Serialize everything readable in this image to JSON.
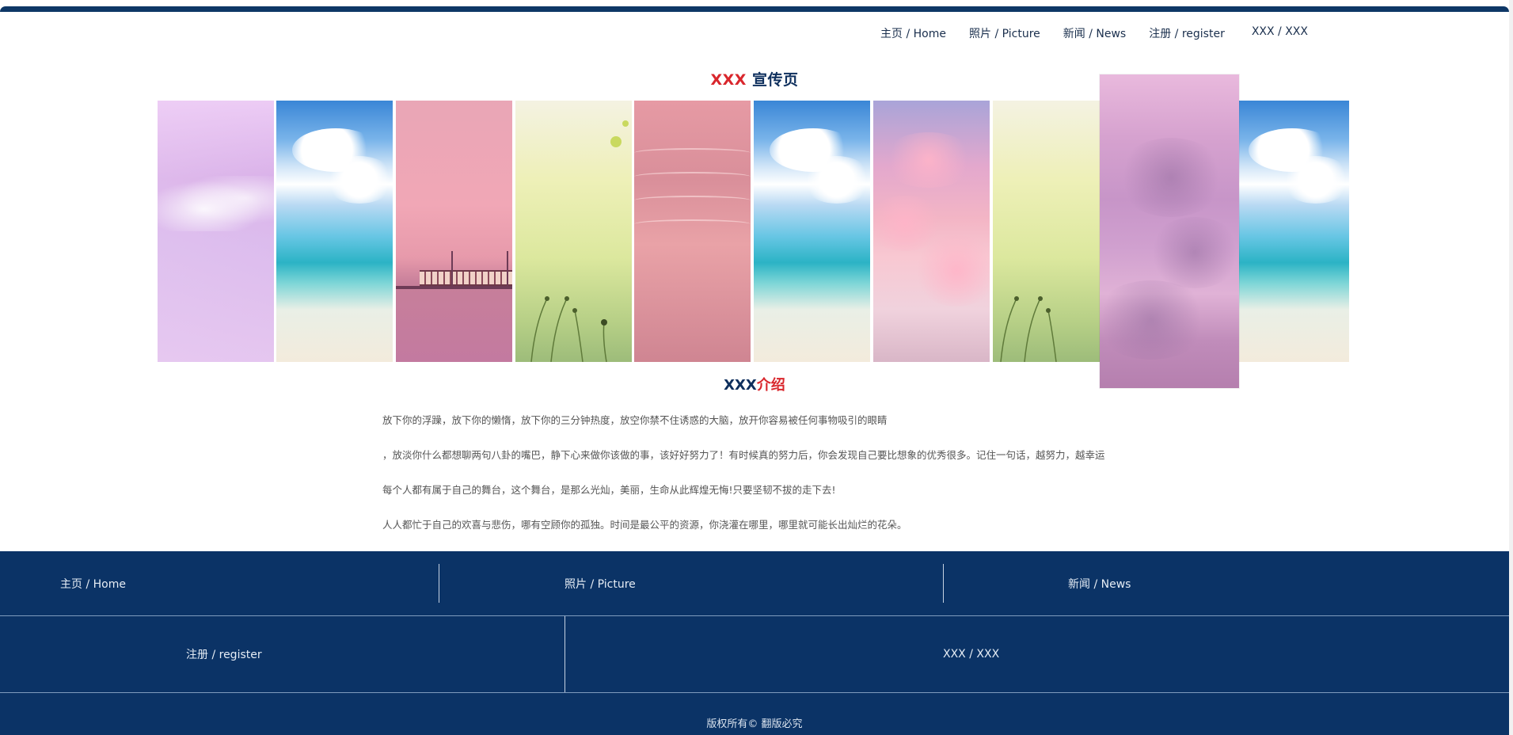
{
  "nav": {
    "home": "主页 / Home",
    "picture": "照片 / Picture",
    "news": "新闻 / News",
    "register": "注册 / register",
    "xxx": "XXX / XXX"
  },
  "headline": {
    "red_part": "XXX",
    "navy_part": " 宣传页"
  },
  "gallery": {
    "panels": [
      "waves",
      "beach",
      "train",
      "grass",
      "sand",
      "beach",
      "sky",
      "grass",
      "cloud",
      "beach"
    ],
    "highlighted_index": 8
  },
  "intro_title": {
    "navy_part": "XXX",
    "red_part": "介绍"
  },
  "intro_paragraphs": [
    "放下你的浮躁，放下你的懒惰，放下你的三分钟热度，放空你禁不住诱惑的大脑，放开你容易被任何事物吸引的眼睛",
    "，放淡你什么都想聊两句八卦的嘴巴，静下心来做你该做的事，该好好努力了！有时候真的努力后，你会发现自己要比想象的优秀很多。记住一句话，越努力，越幸运",
    "每个人都有属于自己的舞台，这个舞台，是那么光灿，美丽，生命从此辉煌无悔!只要坚韧不拔的走下去!",
    "人人都忙于自己的欢喜与悲伤，哪有空顾你的孤独。时间是最公平的资源，你浇灌在哪里，哪里就可能长出灿烂的花朵。"
  ],
  "footer": {
    "home": "主页 / Home",
    "picture": "照片 / Picture",
    "news": "新闻 / News",
    "register": "注册 / register",
    "xxx": "XXX / XXX",
    "copyright": "版权所有© 翻版必究"
  },
  "colors": {
    "navy": "#0b3366",
    "red": "#d9262c"
  }
}
